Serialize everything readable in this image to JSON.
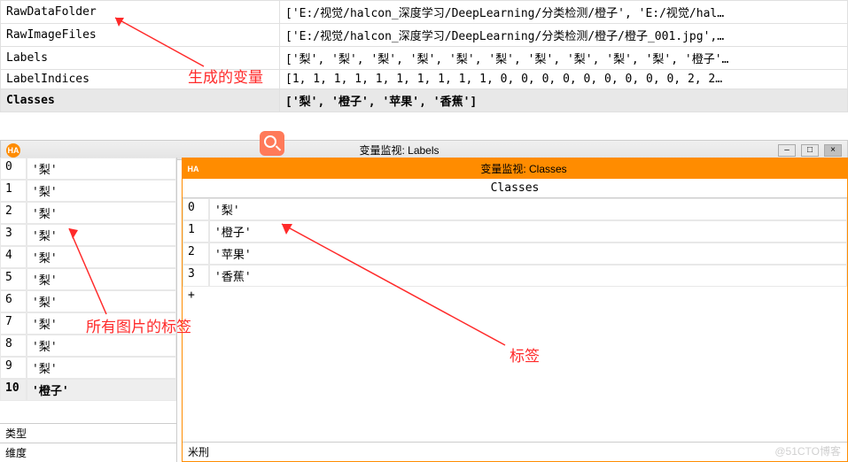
{
  "vars": [
    {
      "name": "RawDataFolder",
      "value": "['E:/视觉/halcon_深度学习/DeepLearning/分类检测/橙子', 'E:/视觉/hal…"
    },
    {
      "name": "RawImageFiles",
      "value": "['E:/视觉/halcon_深度学习/DeepLearning/分类检测/橙子/橙子_001.jpg',…"
    },
    {
      "name": "Labels",
      "value": "['梨', '梨', '梨', '梨', '梨', '梨', '梨', '梨', '梨', '梨', '橙子'…"
    },
    {
      "name": "LabelIndices",
      "value": "[1, 1, 1, 1, 1, 1, 1, 1, 1, 1, 0, 0, 0, 0, 0, 0, 0, 0, 0, 2, 2…"
    },
    {
      "name": "Classes",
      "value": "['梨', '橙子', '苹果', '香蕉']",
      "sel": true
    }
  ],
  "labels_titlebar": "变量监视: Labels",
  "classes_titlebar": "变量监视: Classes",
  "classes_header": "Classes",
  "labels_list": [
    {
      "i": "0",
      "v": "'梨'"
    },
    {
      "i": "1",
      "v": "'梨'"
    },
    {
      "i": "2",
      "v": "'梨'"
    },
    {
      "i": "3",
      "v": "'梨'"
    },
    {
      "i": "4",
      "v": "'梨'"
    },
    {
      "i": "5",
      "v": "'梨'"
    },
    {
      "i": "6",
      "v": "'梨'"
    },
    {
      "i": "7",
      "v": "'梨'"
    },
    {
      "i": "8",
      "v": "'梨'"
    },
    {
      "i": "9",
      "v": "'梨'"
    },
    {
      "i": "10",
      "v": "'橙子'",
      "sel": true
    }
  ],
  "classes_list": [
    {
      "i": "0",
      "v": "'梨'"
    },
    {
      "i": "1",
      "v": "'橙子'"
    },
    {
      "i": "2",
      "v": "'苹果'"
    },
    {
      "i": "3",
      "v": "'香蕉'"
    }
  ],
  "footer_left_type": "类型",
  "footer_left_dim": "维度",
  "footer_right": "米刑",
  "anno1": "生成的变量",
  "anno2": "所有图片的标签",
  "anno3": "标签",
  "watermark": "@51CTO博客"
}
